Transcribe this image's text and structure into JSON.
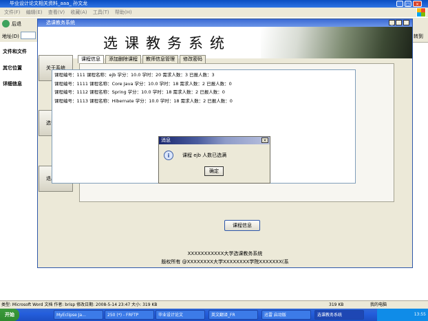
{
  "outer_window": {
    "title": "毕业设计论文相关资料_aaa_ 孙文龙",
    "menu": [
      "文件(F)",
      "编辑(E)",
      "查看(V)",
      "收藏(A)",
      "工具(T)",
      "帮助(H)"
    ],
    "back_label": "后退",
    "address_label": "地址(D)",
    "right_edge_label": "转到",
    "sidebar": [
      "文件和文件",
      "其它位置",
      "详细信息"
    ]
  },
  "app": {
    "title": "选课教务系统",
    "banner_title": "选课教务系统",
    "nav_buttons": [
      "关于系统",
      "选课规则",
      "退出系统"
    ],
    "tabs": [
      "课程信息",
      "添加删除课程",
      "教师信息管理",
      "修改密码"
    ],
    "courses": [
      "课程编号：111  课程名称：ejb  学分：10.0  学时：20  需求人数：3  已报人数：3",
      "课程编号：1111  课程名称：Core Java  学分：10.0  学时：18  需求人数：2  已报人数：0",
      "课程编号：1112  课程名称：Spring  学分：10.0  学时：18  需求人数：2  已报人数：0",
      "课程编号：1113  课程名称：Hibernate  学分：10.0  学时：18  需求人数：2  已报人数：0"
    ],
    "course_button": "课程信息",
    "footer_line1": "XXXXXXXXXXX大学选课教务系统",
    "footer_line2": "版权所有 @XXXXXXXX大学XXXXXXXX学院XXXXXXX(系"
  },
  "dialog": {
    "title": "消息",
    "message": "课程 ejb 人数已选满",
    "ok_label": "确定"
  },
  "status_bar": {
    "left": "类型: Microsoft Word 文档 作者: brisp 修改日期: 2008-5-14 23:47 大小: 319 KB",
    "size": "319 KB",
    "location": "我的电脑"
  },
  "taskbar": {
    "start_label": "开始",
    "tasks": [
      "MyEclipse Ja...",
      "250 (*) - FRFTP",
      "毕业设计论文",
      "英文翻译_FR",
      "迅雷 启动版",
      "选课教务系统"
    ],
    "clock": "13:55"
  },
  "colors": {
    "title_blue": "#0a4ec2",
    "taskbar_blue": "#245edc",
    "window_face": "#ece9d8"
  }
}
